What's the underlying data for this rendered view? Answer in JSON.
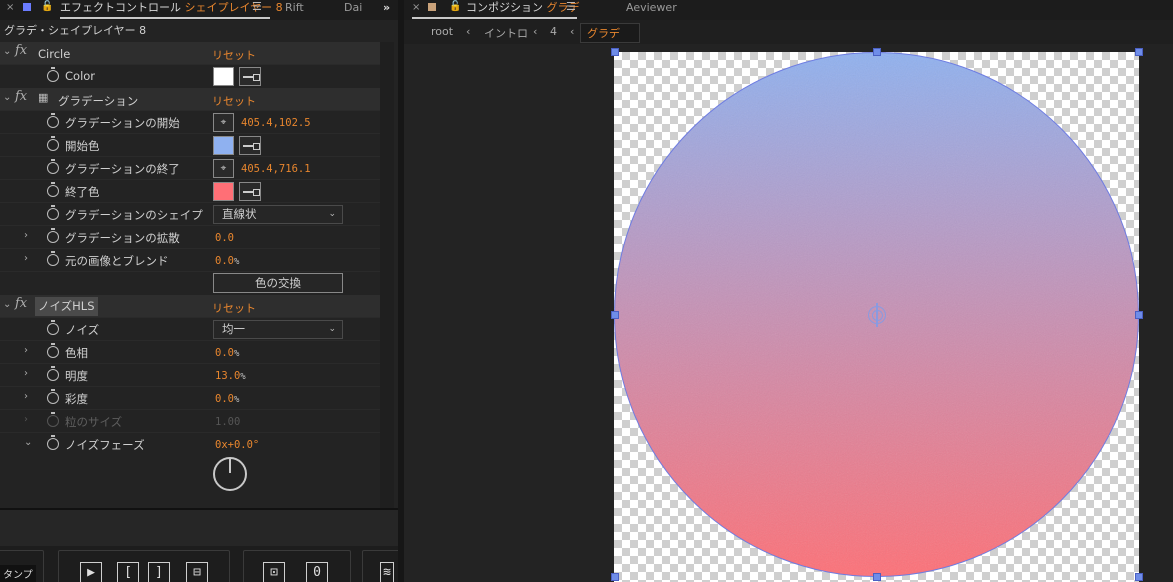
{
  "left_panel": {
    "tab_effect_prefix": "エフェクトコントロール",
    "tab_effect_layer": "シェイプレイヤー 8",
    "tab_rift": "Rift",
    "tab_dai": "Dai",
    "layer_title": "グラデ・シェイプレイヤー 8",
    "reset_label": "リセット",
    "effects": {
      "circle": {
        "name": "Circle",
        "color_label": "Color",
        "color": "#ffffff"
      },
      "gradient": {
        "name": "グラデーション",
        "start_label": "グラデーションの開始",
        "start_value": "405.4,102.5",
        "start_color_label": "開始色",
        "start_color": "#8fb1f0",
        "end_label": "グラデーションの終了",
        "end_value": "405.4,716.1",
        "end_color_label": "終了色",
        "end_color": "#ff6f76",
        "shape_label": "グラデーションのシェイプ",
        "shape_value": "直線状",
        "scatter_label": "グラデーションの拡散",
        "scatter_value": "0.0",
        "blend_label": "元の画像とブレンド",
        "blend_value": "0.0",
        "blend_unit": "%",
        "swap_button": "色の交換"
      },
      "noise_hls": {
        "name": "ノイズHLS",
        "noise_label": "ノイズ",
        "noise_value": "均一",
        "hue_label": "色相",
        "hue_value": "0.0",
        "hue_unit": "%",
        "lightness_label": "明度",
        "lightness_value": "13.0",
        "lightness_unit": "%",
        "saturation_label": "彩度",
        "saturation_value": "0.0",
        "saturation_unit": "%",
        "grain_label": "粒のサイズ",
        "grain_value": "1.00",
        "phase_label": "ノイズフェーズ",
        "phase_value": "0x+0.0°"
      }
    },
    "bottom": {
      "stamp_label": "タンプ",
      "btn_play": "▶",
      "btn_in": "[",
      "btn_out": "]",
      "btn_save": "⊟",
      "btn_center": "⊡",
      "btn_zero": "0",
      "btn_wave": "≋"
    }
  },
  "right_panel": {
    "tab_comp_prefix": "コンポジション",
    "tab_comp_name": "グラデ",
    "tab_aeviewer": "Aeviewer",
    "breadcrumbs": [
      "root",
      "イントロ",
      "4",
      "グラデ"
    ],
    "gradient_top": "#8fb1f0",
    "gradient_bottom": "#ff6f76"
  }
}
